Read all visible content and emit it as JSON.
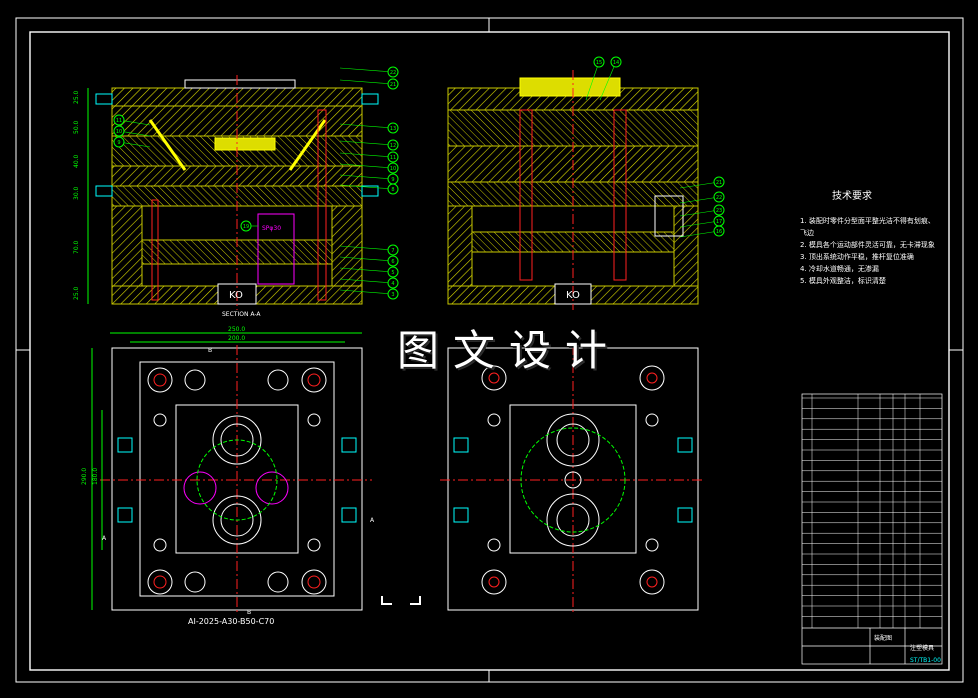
{
  "watermark": "图文设计",
  "section_label": "SECTION A-A",
  "part_code": "AI-2025-A30-B50-C70",
  "ko_labels": [
    "KO",
    "KO"
  ],
  "sprue_label": "SPφ30",
  "dims_top": [
    "250.0",
    "200.0"
  ],
  "dims_left": [
    "290.0",
    "180.0"
  ],
  "dims_vertical": [
    "25.0",
    "50.0",
    "40.0",
    "30.0",
    "70.0",
    "25.0"
  ],
  "section_markers": [
    "B",
    "B",
    "A",
    "A"
  ],
  "balloons_left": [
    "22",
    "21",
    "13",
    "12",
    "11",
    "10",
    "9",
    "8",
    "7",
    "6",
    "5",
    "4",
    "3",
    "2",
    "1",
    "19",
    "20",
    "18"
  ],
  "balloons_right": [
    "15",
    "16",
    "21",
    "22",
    "23",
    "17",
    "16",
    "14"
  ],
  "tech_title": "技术要求",
  "tech_lines": [
    "1. 装配时零件分型面平整光洁不得有划痕、飞边",
    "2. 模具各个运动部件灵活可靠，无卡滞现象",
    "3. 顶出系统动作平稳，推杆复位准确",
    "4. 冷却水道畅通，无渗漏",
    "5. 模具外观整洁，标识清楚"
  ],
  "title_block": {
    "drawing_name": "装配图",
    "unit": "注塑模具",
    "code": "ST/TB1-00"
  },
  "colors": {
    "frame": "#ffffff",
    "plate": "#c8c800",
    "hatch": "#ffff00",
    "center": "#ff2020",
    "callout": "#00ff00",
    "cyan": "#00ffff",
    "magenta": "#ff00ff",
    "blue": "#4060ff",
    "dimension": "#00ff00"
  }
}
